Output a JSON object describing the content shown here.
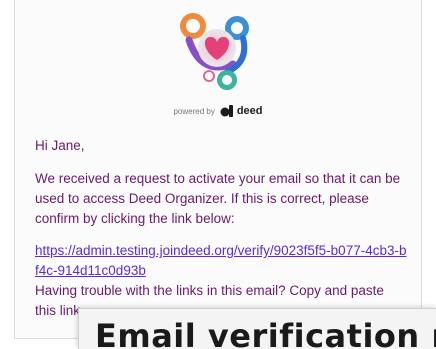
{
  "email": {
    "powered_by": "powered by",
    "brand_name": "deed",
    "greeting": "Hi Jane,",
    "body_paragraph": "We received a request to activate your email so that it can be used to access Deed Organizer. If this is correct, please confirm by clicking the link below:",
    "verify_link": "https://admin.testing.joindeed.org/verify/9023f5f5-b077-4cb3-bf4c-914d11c0d93b",
    "trouble_text": "Having trouble with the links in this email? Copy and paste this link"
  },
  "overlay": {
    "title": "Email verification required"
  },
  "colors": {
    "text": "#6b1a6b",
    "link": "#5b2bd6",
    "logo_orange": "#f08a3c",
    "logo_blue": "#3a8fd9",
    "logo_pink": "#e4407a",
    "logo_green": "#3cb39a"
  }
}
